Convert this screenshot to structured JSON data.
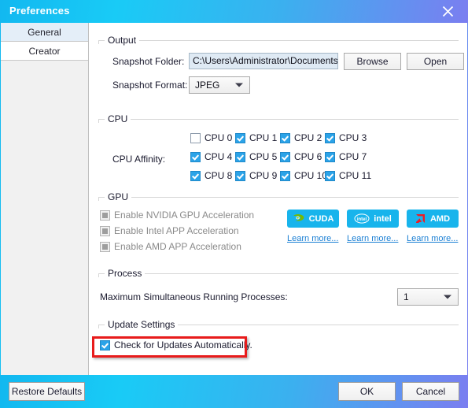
{
  "window": {
    "title": "Preferences",
    "close_icon": "close-icon"
  },
  "sidebar": {
    "items": [
      {
        "label": "General",
        "selected": true
      },
      {
        "label": "Creator",
        "selected": false
      }
    ]
  },
  "output": {
    "group_label": "Output",
    "snapshot_folder_label": "Snapshot Folder:",
    "snapshot_folder_value": "C:\\Users\\Administrator\\Documents\\A",
    "browse_label": "Browse",
    "open_label": "Open",
    "snapshot_format_label": "Snapshot Format:",
    "snapshot_format_value": "JPEG"
  },
  "cpu": {
    "group_label": "CPU",
    "affinity_label": "CPU Affinity:",
    "cores": [
      {
        "label": "CPU 0",
        "checked": false
      },
      {
        "label": "CPU 1",
        "checked": true
      },
      {
        "label": "CPU 2",
        "checked": true
      },
      {
        "label": "CPU 3",
        "checked": true
      },
      {
        "label": "CPU 4",
        "checked": true
      },
      {
        "label": "CPU 5",
        "checked": true
      },
      {
        "label": "CPU 6",
        "checked": true
      },
      {
        "label": "CPU 7",
        "checked": true
      },
      {
        "label": "CPU 8",
        "checked": true
      },
      {
        "label": "CPU 9",
        "checked": true
      },
      {
        "label": "CPU 10",
        "checked": true
      },
      {
        "label": "CPU 11",
        "checked": true
      }
    ]
  },
  "gpu": {
    "group_label": "GPU",
    "options": [
      {
        "label": "Enable NVIDIA GPU Acceleration",
        "checked": false,
        "disabled": true
      },
      {
        "label": "Enable Intel APP Acceleration",
        "checked": false,
        "disabled": true
      },
      {
        "label": "Enable AMD APP Acceleration",
        "checked": false,
        "disabled": true
      }
    ],
    "brands": [
      {
        "name": "CUDA",
        "icon": "nvidia-logo-icon",
        "learn_more": "Learn more..."
      },
      {
        "name": "intel",
        "icon": "intel-logo-icon",
        "learn_more": "Learn more..."
      },
      {
        "name": "AMD",
        "icon": "amd-logo-icon",
        "learn_more": "Learn more..."
      }
    ],
    "brand_button_color": "#18b4ec",
    "link_color": "#1a7fd4"
  },
  "process": {
    "group_label": "Process",
    "max_processes_label": "Maximum Simultaneous Running Processes:",
    "max_processes_value": "1"
  },
  "update_settings": {
    "group_label": "Update Settings",
    "check_updates_label": "Check for Updates Automatically.",
    "check_updates_checked": true,
    "highlight_color": "#e81b1b"
  },
  "footer": {
    "restore_defaults_label": "Restore Defaults",
    "ok_label": "OK",
    "cancel_label": "Cancel"
  },
  "theme": {
    "titlebar_gradient_start": "#12b8f0",
    "titlebar_gradient_end": "#7b7ef0",
    "checkbox_accent": "#2ba3e8"
  }
}
